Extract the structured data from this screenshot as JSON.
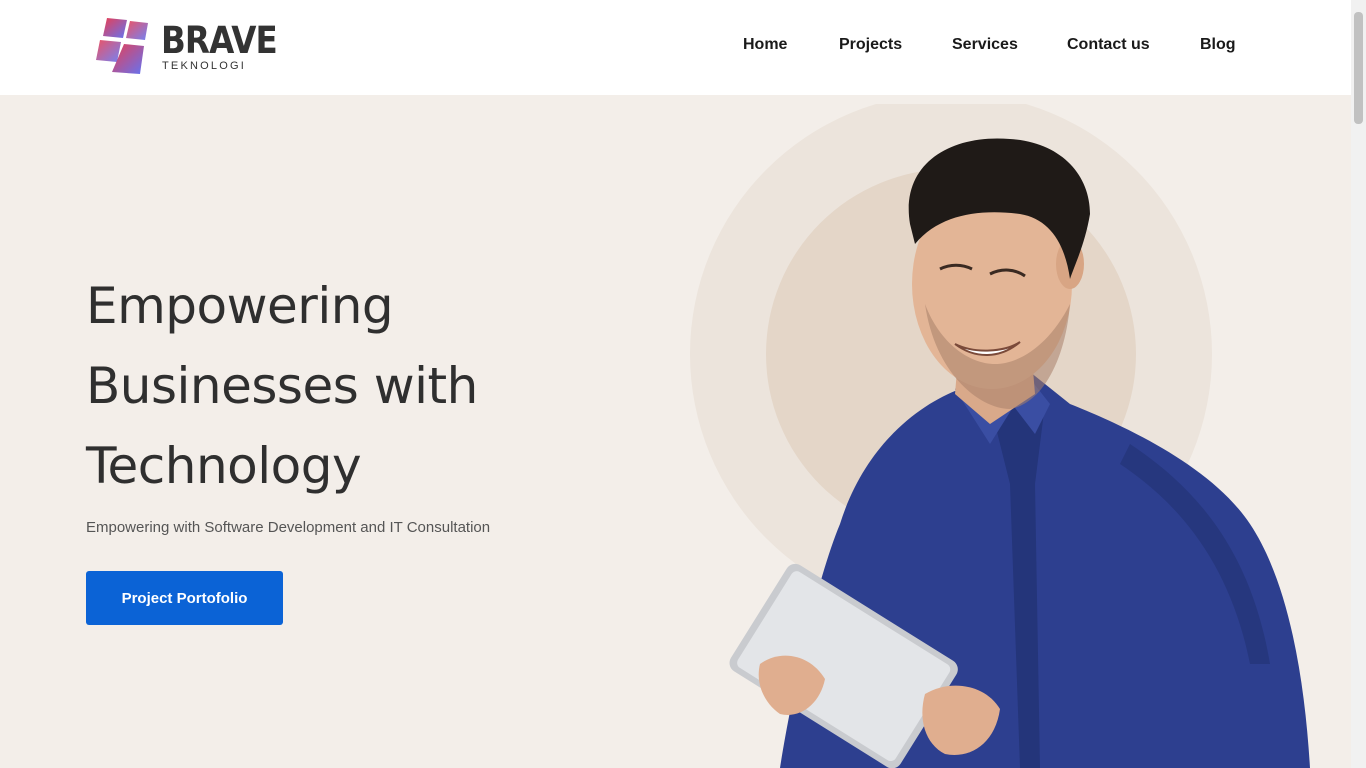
{
  "brand": {
    "name": "BRAVE",
    "tagline": "TEKNOLOGI"
  },
  "nav": {
    "items": [
      {
        "label": "Home"
      },
      {
        "label": "Projects"
      },
      {
        "label": "Services"
      },
      {
        "label": "Contact us"
      },
      {
        "label": "Blog"
      }
    ]
  },
  "hero": {
    "title_line1": "Empowering",
    "title_line2": "Businesses with",
    "title_line3": "Technology",
    "subtitle": "Empowering with Software Development and IT Consultation",
    "cta_label": "Project Portofolio",
    "image_icon": "man-with-tablet-illustration"
  },
  "colors": {
    "background": "#f3eee9",
    "header": "#ffffff",
    "primary_button": "#0b63d6",
    "shirt": "#2d3f8f",
    "logo_gradient_start": "#e8344a",
    "logo_gradient_end": "#5b6cf2"
  }
}
